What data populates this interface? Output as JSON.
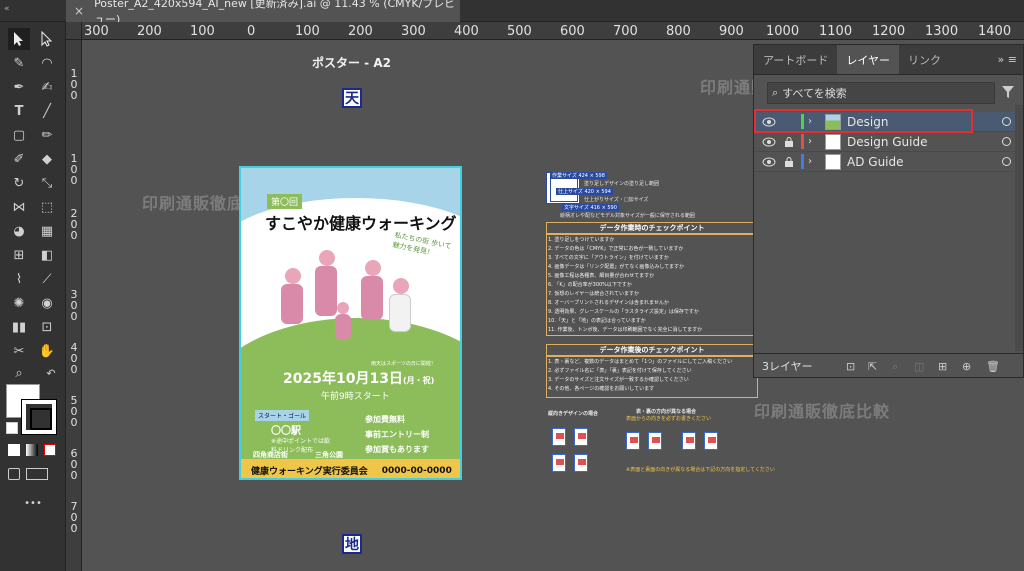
{
  "window": {
    "tab_title": "Poster_A2_420x594_AI_new [更新済み].ai @ 11.43 % (CMYK/プレビュー)",
    "tab_close": "×"
  },
  "ruler": {
    "h_labels": [
      "300",
      "200",
      "100",
      "0",
      "100",
      "200",
      "300",
      "400",
      "500",
      "600",
      "700",
      "800",
      "900",
      "1000",
      "1100",
      "1200",
      "1300",
      "1400"
    ],
    "v_labels": [
      "1",
      "0",
      "0",
      "1",
      "0",
      "0",
      "2",
      "0",
      "0",
      "3",
      "0",
      "0",
      "4",
      "0",
      "0",
      "5",
      "0",
      "0",
      "6",
      "0",
      "0",
      "7",
      "0",
      "0"
    ]
  },
  "canvas": {
    "artboard_label": "ポスター - A2",
    "top_mark": "天",
    "bottom_mark": "地",
    "watermark": "印刷通販徹底比較"
  },
  "poster": {
    "badge": "第〇回",
    "title": "すこやか健康ウォーキング",
    "subtitle": "私たちの街 歩いて魅力を発見！",
    "note": "雨天はスポーツの日に開催！",
    "date": "2025年10月13日",
    "date_suffix": "(月・祝)",
    "time": "午前9時スタート",
    "start_goal": "スタート・ゴール",
    "station": "〇〇駅",
    "hydration": "※途中ポイントでは飲料ドリンク配布",
    "shop": "四角商店街",
    "park": "三角公園",
    "perks": [
      "参加費無料",
      "事前エントリー制",
      "参加賞もあります"
    ],
    "organizer": "健康ウォーキング実行委員会",
    "phone": "0000-00-0000"
  },
  "guide": {
    "size_labels": [
      "作業サイズ 424 × 598",
      "塗り足しデザインの塗り足し範囲",
      "仕上サイズ 420 × 594",
      "仕上がりサイズ・□加サイズ",
      "文字サイズ 416 × 590",
      "絵柄オレや配などモデル対象サイズが一般に保守される範囲"
    ],
    "check_head": "データ作業時のチェックポイント",
    "check_items": [
      "1. 塗り足しをつけていますか",
      "2. データの色は「CMYK」で正常にお色が一致していますか",
      "3. すべての文字に「アウトライン」を付けていますか",
      "4. 画像データは「リンク配置」がてなく画像込みしてますか",
      "5. 画像工程は各種表、細目量が合わせてますか",
      "6. 「K」の配合率が300%以下ですか",
      "7. 仮想のレイヤーは統合されていますか",
      "8. オーバープリントされるデザインは含まれませんか",
      "9. 透明効果、グレースケールの「ラスタライズ設定」は保存ですか",
      "10.「天」と「地」の表記は合っていますか",
      "11. 作業後、トンボ後、データは印刷範囲でなく完全に消してますか"
    ],
    "after_head": "データ作業後のチェックポイント",
    "after_items": [
      "1. 表・裏など、複数のデータはまとめて「1つ」のファイルにしてご入稿ください",
      "2. 必ずファイル名に「表」「裏」表記を付けて保存してください",
      "3. データのサイズと注文サイズが一致するか確認してください",
      "4. その他、各ページの確認をお願いしています"
    ],
    "same_dir": "縦向きデザインの場合",
    "diff_dir": "表・裏の方向が異なる場合",
    "diff_note": "表面からの向きを必ずお書きください",
    "sheet_labels": [
      "表",
      "裏",
      "表",
      "裏",
      "表",
      "裏"
    ],
    "footnote": "※表面と裏面の向きが異なる場合は下記の方向を指定してください"
  },
  "layers_panel": {
    "tabs": [
      "アートボード",
      "レイヤー",
      "リンク"
    ],
    "active_tab": "レイヤー",
    "menu": "»  ≡",
    "search_placeholder": "すべてを検索",
    "layers": [
      {
        "name": "Design",
        "color": "#4cd44c",
        "locked": false,
        "selected": true
      },
      {
        "name": "Design Guide",
        "color": "#e05050",
        "locked": true,
        "selected": false
      },
      {
        "name": "AD Guide",
        "color": "#4a7ae0",
        "locked": true,
        "selected": false
      }
    ],
    "footer_count": "3レイヤー"
  },
  "toolbar": {
    "more": "•••"
  }
}
